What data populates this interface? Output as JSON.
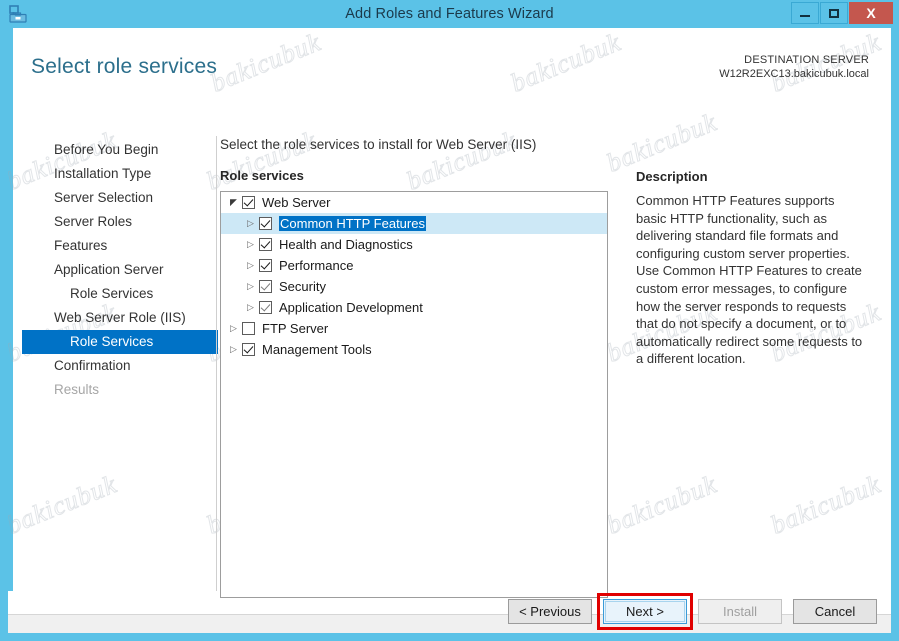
{
  "window": {
    "title": "Add Roles and Features Wizard",
    "icon": "server-manager-icon",
    "minimize_label": "Minimize",
    "maximize_label": "Maximize",
    "close_label": "X",
    "frame_color": "#5bc2e7",
    "close_color": "#c4574e"
  },
  "header": {
    "page_title": "Select role services",
    "destination_label": "DESTINATION SERVER",
    "destination_server": "W12R2EXC13.bakicubuk.local"
  },
  "nav": {
    "items": [
      {
        "label": "Before You Begin",
        "state": "normal",
        "indent": 0
      },
      {
        "label": "Installation Type",
        "state": "normal",
        "indent": 0
      },
      {
        "label": "Server Selection",
        "state": "normal",
        "indent": 0
      },
      {
        "label": "Server Roles",
        "state": "normal",
        "indent": 0
      },
      {
        "label": "Features",
        "state": "normal",
        "indent": 0
      },
      {
        "label": "Application Server",
        "state": "normal",
        "indent": 0
      },
      {
        "label": "Role Services",
        "state": "normal",
        "indent": 1
      },
      {
        "label": "Web Server Role (IIS)",
        "state": "normal",
        "indent": 0
      },
      {
        "label": "Role Services",
        "state": "selected",
        "indent": 1
      },
      {
        "label": "Confirmation",
        "state": "normal",
        "indent": 0
      },
      {
        "label": "Results",
        "state": "disabled",
        "indent": 0
      }
    ],
    "selected_color": "#0072c6"
  },
  "main": {
    "instruction": "Select the role services to install for Web Server (IIS)",
    "section_label": "Role services",
    "tree": [
      {
        "label": "Web Server",
        "checked": true,
        "dim": false,
        "expanded": true,
        "depth": 0,
        "selected": false
      },
      {
        "label": "Common HTTP Features",
        "checked": true,
        "dim": false,
        "expanded": false,
        "depth": 1,
        "selected": true
      },
      {
        "label": "Health and Diagnostics",
        "checked": true,
        "dim": false,
        "expanded": false,
        "depth": 1,
        "selected": false
      },
      {
        "label": "Performance",
        "checked": true,
        "dim": false,
        "expanded": false,
        "depth": 1,
        "selected": false
      },
      {
        "label": "Security",
        "checked": true,
        "dim": true,
        "expanded": false,
        "depth": 1,
        "selected": false
      },
      {
        "label": "Application Development",
        "checked": true,
        "dim": true,
        "expanded": false,
        "depth": 1,
        "selected": false
      },
      {
        "label": "FTP Server",
        "checked": false,
        "dim": false,
        "expanded": false,
        "depth": 0,
        "selected": false
      },
      {
        "label": "Management Tools",
        "checked": true,
        "dim": false,
        "expanded": false,
        "depth": 0,
        "selected": false
      }
    ]
  },
  "description": {
    "title": "Description",
    "text": "Common HTTP Features supports basic HTTP functionality, such as delivering standard file formats and configuring custom server properties. Use Common HTTP Features to create custom error messages, to configure how the server responds to requests that do not specify a document, or to automatically redirect some requests to a different location."
  },
  "footer": {
    "previous_label": "< Previous",
    "next_label": "Next >",
    "install_label": "Install",
    "cancel_label": "Cancel",
    "install_enabled": false,
    "next_focused": true,
    "annotation_color": "#e00000"
  },
  "watermark": {
    "text": "bakicubuk"
  }
}
